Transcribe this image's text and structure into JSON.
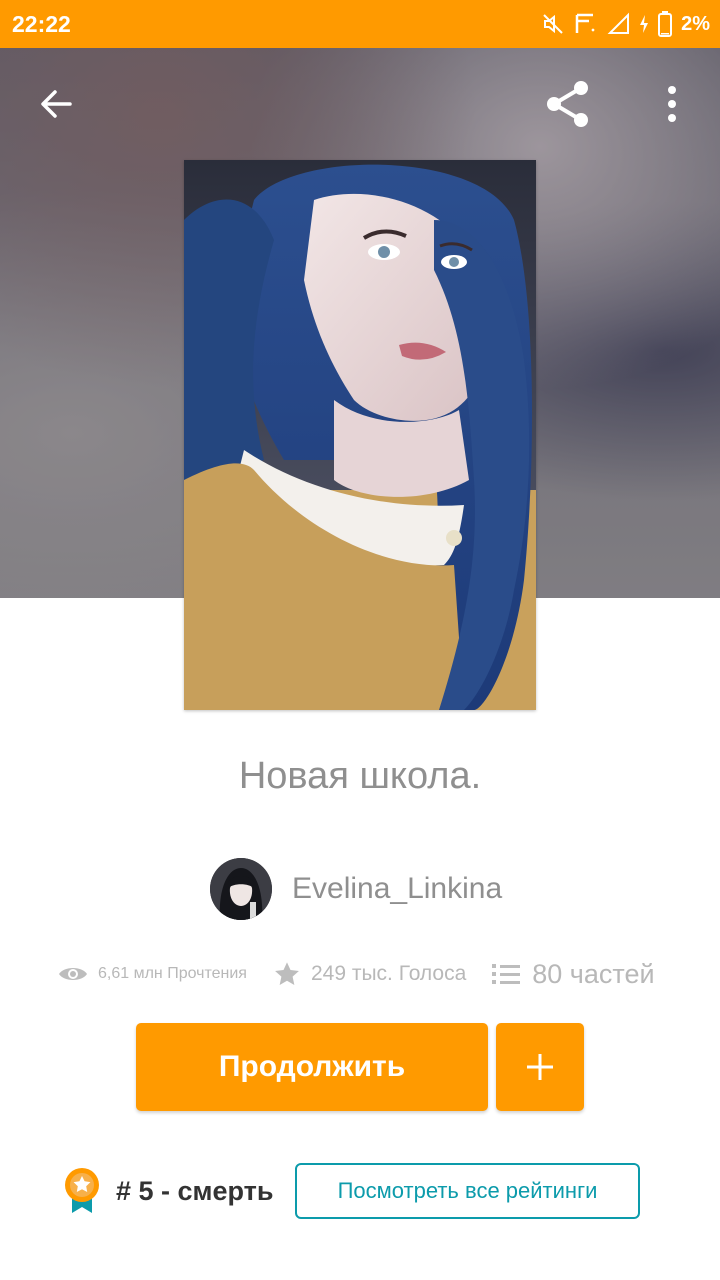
{
  "status_bar": {
    "time": "22:22",
    "battery": "2%",
    "color": "#ff9a00"
  },
  "header": {
    "icons": [
      "back-arrow-icon",
      "share-icon",
      "more-vert-icon"
    ]
  },
  "story": {
    "title": "Новая школа.",
    "author": "Evelina_Linkina",
    "stats": {
      "reads": "6,61 млн Прочтения",
      "votes": "249 тыс. Голоса",
      "parts": "80 частей"
    }
  },
  "actions": {
    "continue_label": "Продолжить",
    "add_icon": "plus-icon",
    "accent_color": "#ff9a00"
  },
  "ranking": {
    "text": "# 5 - смерть",
    "view_all_label": "Посмотреть все рейтинги",
    "link_color": "#0c9bab"
  }
}
